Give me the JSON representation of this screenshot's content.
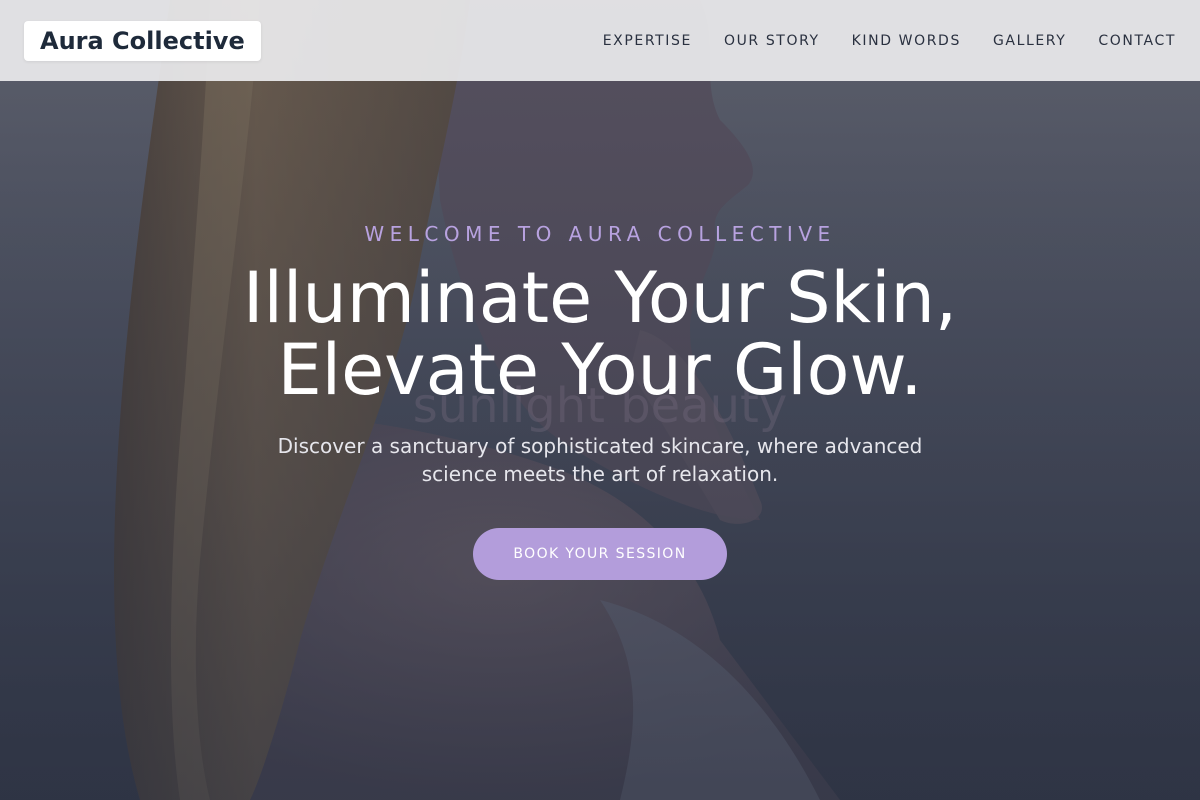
{
  "brand": {
    "name": "Aura Collective"
  },
  "nav": {
    "items": [
      {
        "label": "EXPERTISE"
      },
      {
        "label": "OUR STORY"
      },
      {
        "label": "KIND WORDS"
      },
      {
        "label": "GALLERY"
      },
      {
        "label": "CONTACT"
      }
    ]
  },
  "hero": {
    "eyebrow": "WELCOME TO AURA COLLECTIVE",
    "headline_line1": "Illuminate Your Skin,",
    "headline_line2": "Elevate Your Glow.",
    "watermark": "sunlight beauty",
    "subtext": "Discover a sanctuary of sophisticated skincare, where advanced science meets the art of relaxation.",
    "cta_label": "BOOK YOUR SESSION"
  },
  "colors": {
    "accent": "#b39ddb",
    "eyebrow": "#b8a2e0",
    "logo_text": "#1e2a3a",
    "nav_text": "#2a3140"
  }
}
